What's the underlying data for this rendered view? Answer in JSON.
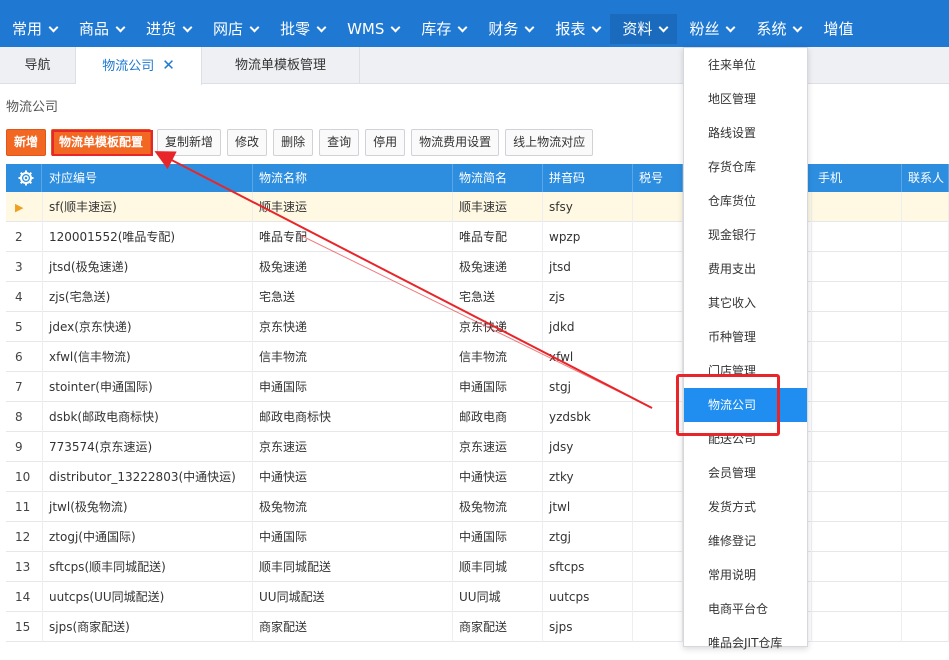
{
  "top_menu": [
    {
      "label": "常用"
    },
    {
      "label": "商品"
    },
    {
      "label": "进货"
    },
    {
      "label": "网店"
    },
    {
      "label": "批零"
    },
    {
      "label": "WMS"
    },
    {
      "label": "库存"
    },
    {
      "label": "财务"
    },
    {
      "label": "报表"
    },
    {
      "label": "资料"
    },
    {
      "label": "粉丝"
    },
    {
      "label": "系统"
    },
    {
      "label": "增值"
    }
  ],
  "tabs": [
    {
      "label": "导航"
    },
    {
      "label": "物流公司",
      "close": "✕"
    },
    {
      "label": "物流单模板管理"
    }
  ],
  "page_title": "物流公司",
  "toolbar": [
    {
      "label": "新增"
    },
    {
      "label": "物流单模板配置"
    },
    {
      "label": "复制新增"
    },
    {
      "label": "修改"
    },
    {
      "label": "删除"
    },
    {
      "label": "查询"
    },
    {
      "label": "停用"
    },
    {
      "label": "物流费用设置"
    },
    {
      "label": "线上物流对应"
    }
  ],
  "columns": [
    "对应编号",
    "物流名称",
    "物流简名",
    "拼音码",
    "税号",
    "手机",
    "联系人"
  ],
  "rows": [
    {
      "idx": "",
      "code": "sf(顺丰速运)",
      "name": "顺丰速运",
      "short": "顺丰速运",
      "py": "sfsy"
    },
    {
      "idx": "2",
      "code": "120001552(唯品专配)",
      "name": "唯品专配",
      "short": "唯品专配",
      "py": "wpzp"
    },
    {
      "idx": "3",
      "code": "jtsd(极兔速递)",
      "name": "极兔速递",
      "short": "极兔速递",
      "py": "jtsd"
    },
    {
      "idx": "4",
      "code": "zjs(宅急送)",
      "name": "宅急送",
      "short": "宅急送",
      "py": "zjs"
    },
    {
      "idx": "5",
      "code": "jdex(京东快递)",
      "name": "京东快递",
      "short": "京东快递",
      "py": "jdkd"
    },
    {
      "idx": "6",
      "code": "xfwl(信丰物流)",
      "name": "信丰物流",
      "short": "信丰物流",
      "py": "xfwl"
    },
    {
      "idx": "7",
      "code": "stointer(申通国际)",
      "name": "申通国际",
      "short": "申通国际",
      "py": "stgj"
    },
    {
      "idx": "8",
      "code": "dsbk(邮政电商标快)",
      "name": "邮政电商标快",
      "short": "邮政电商",
      "py": "yzdsbk"
    },
    {
      "idx": "9",
      "code": "773574(京东速运)",
      "name": "京东速运",
      "short": "京东速运",
      "py": "jdsy"
    },
    {
      "idx": "10",
      "code": "distributor_13222803(中通快运)",
      "name": "中通快运",
      "short": "中通快运",
      "py": "ztky"
    },
    {
      "idx": "11",
      "code": "jtwl(极兔物流)",
      "name": "极兔物流",
      "short": "极兔物流",
      "py": "jtwl"
    },
    {
      "idx": "12",
      "code": "ztogj(中通国际)",
      "name": "中通国际",
      "short": "中通国际",
      "py": "ztgj"
    },
    {
      "idx": "13",
      "code": "sftcps(顺丰同城配送)",
      "name": "顺丰同城配送",
      "short": "顺丰同城",
      "py": "sftcps"
    },
    {
      "idx": "14",
      "code": "uutcps(UU同城配送)",
      "name": "UU同城配送",
      "short": "UU同城",
      "py": "uutcps"
    },
    {
      "idx": "15",
      "code": "sjps(商家配送)",
      "name": "商家配送",
      "short": "商家配送",
      "py": "sjps"
    }
  ],
  "dropdown": [
    {
      "label": "往来单位"
    },
    {
      "label": "地区管理"
    },
    {
      "label": "路线设置"
    },
    {
      "label": "存货仓库"
    },
    {
      "label": "仓库货位"
    },
    {
      "label": "现金银行"
    },
    {
      "label": "费用支出"
    },
    {
      "label": "其它收入"
    },
    {
      "label": "币种管理"
    },
    {
      "label": "门店管理"
    },
    {
      "label": "物流公司"
    },
    {
      "label": "配送公司"
    },
    {
      "label": "会员管理"
    },
    {
      "label": "发货方式"
    },
    {
      "label": "维修登记"
    },
    {
      "label": "常用说明"
    },
    {
      "label": "电商平台仓"
    },
    {
      "label": "唯品会JIT仓库"
    }
  ],
  "colors": {
    "header_blue": "#1f78d1",
    "grid_head": "#2d8ee0",
    "primary_orange": "#f26722",
    "annotation_red": "#e8262a",
    "active_item": "#1f8ef0"
  }
}
